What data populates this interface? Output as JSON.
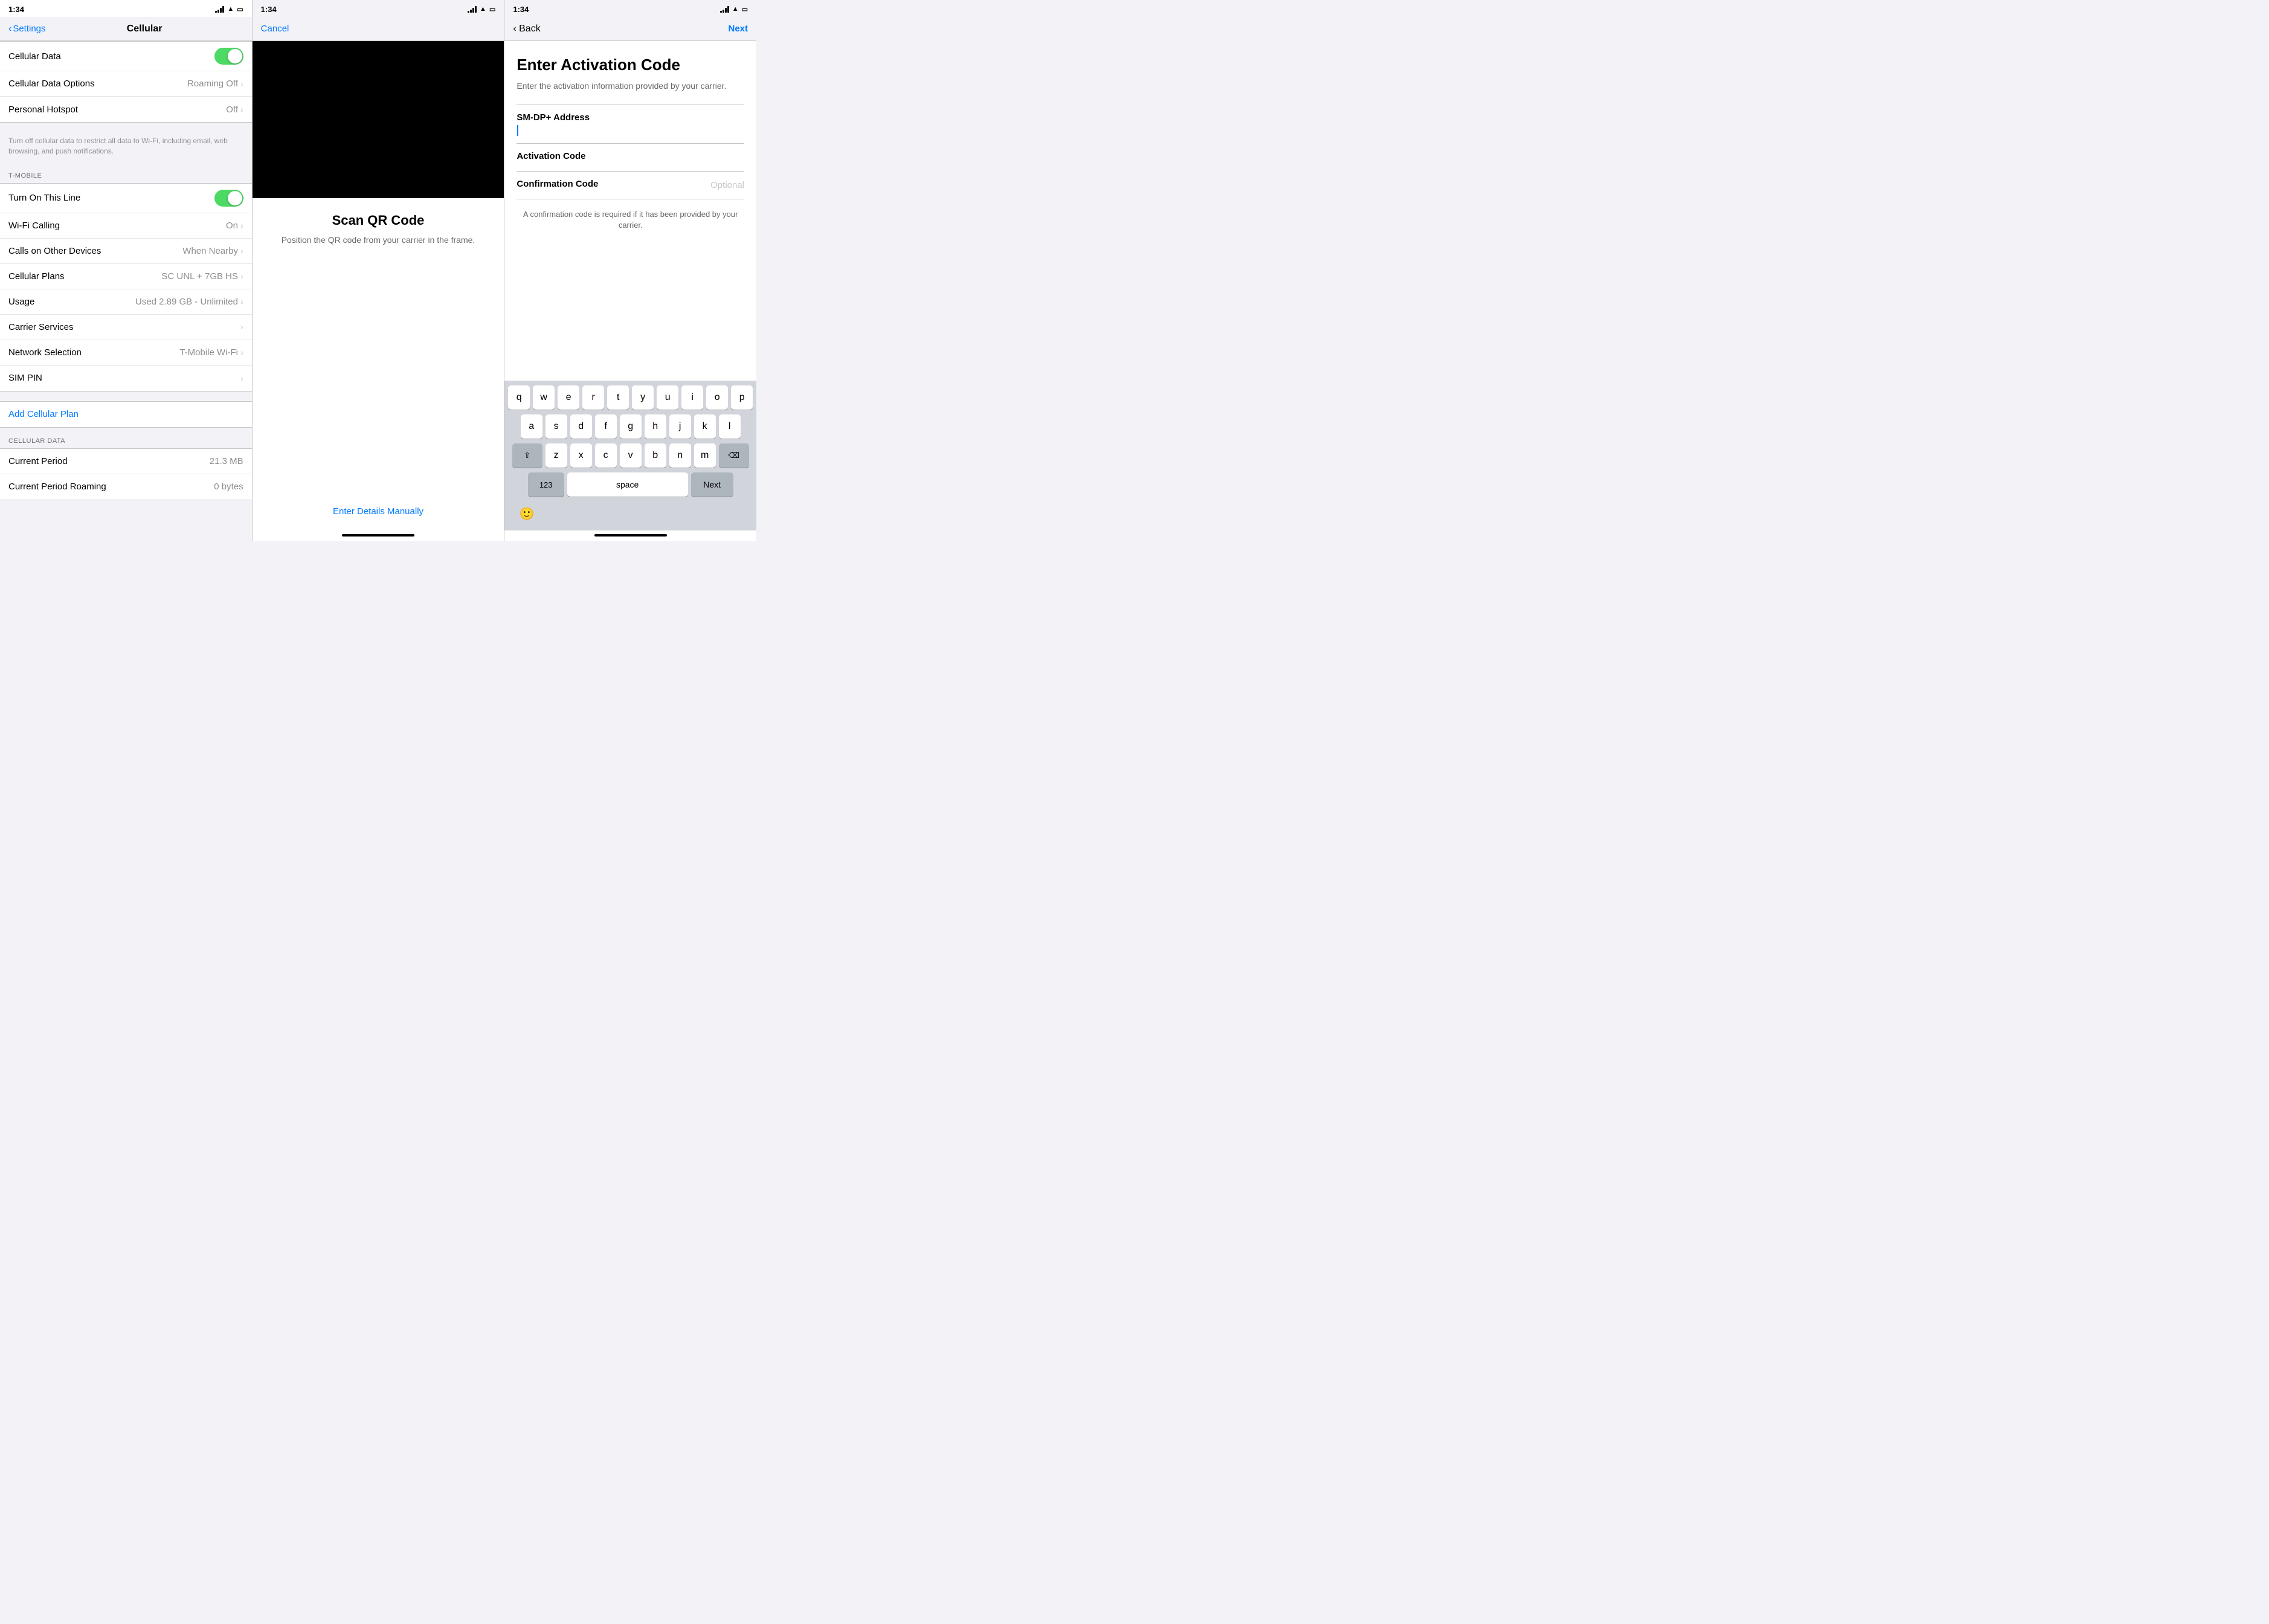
{
  "panel1": {
    "statusBar": {
      "time": "1:34",
      "locationIcon": "◢"
    },
    "navBar": {
      "backLabel": "Settings",
      "title": "Cellular"
    },
    "rows": [
      {
        "label": "Cellular Data",
        "type": "toggle",
        "value": true
      },
      {
        "label": "Cellular Data Options",
        "value": "Roaming Off",
        "hasChevron": true
      },
      {
        "label": "Personal Hotspot",
        "value": "Off",
        "hasChevron": true
      }
    ],
    "note": "Turn off cellular data to restrict all data to Wi-Fi, including email, web browsing, and push notifications.",
    "tmobileSection": "T-MOBILE",
    "tmobileRows": [
      {
        "label": "Turn On This Line",
        "type": "toggle",
        "value": true
      },
      {
        "label": "Wi-Fi Calling",
        "value": "On",
        "hasChevron": true
      },
      {
        "label": "Calls on Other Devices",
        "value": "When Nearby",
        "hasChevron": true
      },
      {
        "label": "Cellular Plans",
        "value": "SC UNL + 7GB HS",
        "hasChevron": true
      },
      {
        "label": "Usage",
        "value": "Used 2.89 GB - Unlimited",
        "hasChevron": true
      },
      {
        "label": "Carrier Services",
        "value": "",
        "hasChevron": true
      },
      {
        "label": "Network Selection",
        "value": "T-Mobile Wi-Fi",
        "hasChevron": true
      },
      {
        "label": "SIM PIN",
        "value": "",
        "hasChevron": true
      }
    ],
    "addCellularPlan": "Add Cellular Plan",
    "cellularDataSection": "CELLULAR DATA",
    "dataRows": [
      {
        "label": "Current Period",
        "value": "21.3 MB"
      },
      {
        "label": "Current Period Roaming",
        "value": "0 bytes"
      }
    ]
  },
  "panel2": {
    "statusBar": {
      "time": "1:34"
    },
    "navBar": {
      "cancelLabel": "Cancel"
    },
    "scanTitle": "Scan QR Code",
    "scanSubtitle": "Position the QR code from your carrier in the frame.",
    "enterManually": "Enter Details Manually"
  },
  "panel3": {
    "statusBar": {
      "time": "1:34"
    },
    "navBar": {
      "backLabel": "Back",
      "nextLabel": "Next"
    },
    "title": "Enter Activation Code",
    "subtitle": "Enter the activation information provided by your carrier.",
    "fields": [
      {
        "label": "SM-DP+ Address",
        "value": "",
        "hasInput": true
      },
      {
        "label": "Activation Code",
        "value": ""
      },
      {
        "label": "Confirmation Code",
        "placeholder": "Optional"
      }
    ],
    "confirmationNote": "A confirmation code is required if it has been provided by your carrier.",
    "keyboard": {
      "row1": [
        "q",
        "w",
        "e",
        "r",
        "t",
        "y",
        "u",
        "i",
        "o",
        "p"
      ],
      "row2": [
        "a",
        "s",
        "d",
        "f",
        "g",
        "h",
        "j",
        "k",
        "l"
      ],
      "row3": [
        "z",
        "x",
        "c",
        "v",
        "b",
        "n",
        "m"
      ],
      "numLabel": "123",
      "spaceLabel": "space",
      "nextLabel": "Next",
      "deleteIcon": "⌫",
      "shiftIcon": "⇧"
    }
  }
}
